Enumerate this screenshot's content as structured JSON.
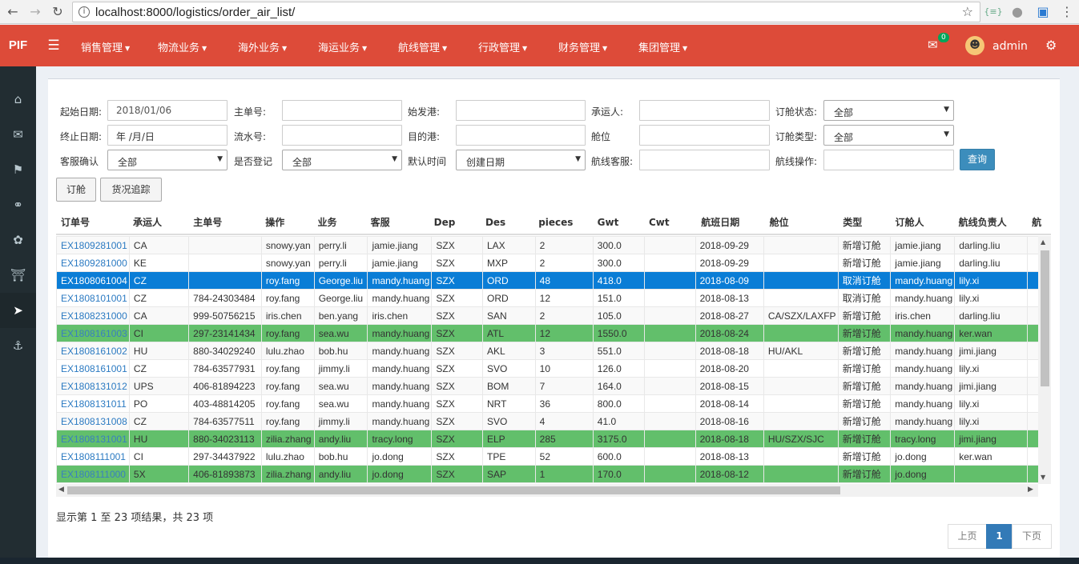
{
  "browser": {
    "url": "localhost:8000/logistics/order_air_list/",
    "back_icon": "back-arrow-icon",
    "forward_icon": "forward-arrow-icon",
    "reload_icon": "reload-icon"
  },
  "header": {
    "logo": "PIF",
    "menu": [
      "销售管理",
      "物流业务",
      "海外业务",
      "海运业务",
      "航线管理",
      "行政管理",
      "财务管理",
      "集团管理"
    ],
    "mail_count": "0",
    "username": "admin",
    "accent_color": "#dd4b39"
  },
  "sidebar": {
    "icons": [
      "home-icon",
      "envelope-icon",
      "flag-icon",
      "link-icon",
      "leaf-icon",
      "bank-icon",
      "rocket-icon",
      "anchor-icon"
    ],
    "active_index": 6
  },
  "filters": {
    "start_date": {
      "label": "起始日期:",
      "value": "2018/01/06"
    },
    "end_date": {
      "label": "终止日期:",
      "value": "年 /月/日"
    },
    "cs_confirm": {
      "label": "客服确认",
      "value": "全部"
    },
    "master_no": {
      "label": "主单号:",
      "value": ""
    },
    "serial_no": {
      "label": "流水号:",
      "value": ""
    },
    "registered": {
      "label": "是否登记",
      "value": "全部"
    },
    "origin_port": {
      "label": "始发港:",
      "value": ""
    },
    "dest_port": {
      "label": "目的港:",
      "value": ""
    },
    "default_time": {
      "label": "默认时间",
      "value": "创建日期"
    },
    "carrier": {
      "label": "承运人:",
      "value": ""
    },
    "cabin": {
      "label": "舱位",
      "value": ""
    },
    "route_cs": {
      "label": "航线客服:",
      "value": ""
    },
    "order_status": {
      "label": "订舱状态:",
      "value": "全部"
    },
    "order_type": {
      "label": "订舱类型:",
      "value": "全部"
    },
    "route_op": {
      "label": "航线操作:",
      "value": ""
    },
    "query_label": "查询"
  },
  "actions": {
    "book_label": "订舱",
    "track_label": "货况追踪"
  },
  "table": {
    "columns": [
      "订单号",
      "承运人",
      "主单号",
      "操作",
      "业务",
      "客服",
      "Dep",
      "Des",
      "pieces",
      "Gwt",
      "Cwt",
      "航班日期",
      "舱位",
      "类型",
      "订舱人",
      "航线负责人",
      "航"
    ],
    "rows": [
      {
        "style": "striped",
        "cells": [
          "EX1809281001",
          "CA",
          "",
          "snowy.yan",
          "perry.li",
          "jamie.jiang",
          "SZX",
          "LAX",
          "2",
          "300.0",
          "",
          "2018-09-29",
          "",
          "新增订舱",
          "jamie.jiang",
          "darling.liu",
          ""
        ]
      },
      {
        "style": "plain",
        "cells": [
          "EX1809281000",
          "KE",
          "",
          "snowy.yan",
          "perry.li",
          "jamie.jiang",
          "SZX",
          "MXP",
          "2",
          "300.0",
          "",
          "2018-09-29",
          "",
          "新增订舱",
          "jamie.jiang",
          "darling.liu",
          ""
        ]
      },
      {
        "style": "selected",
        "cells": [
          "EX1808061004",
          "CZ",
          "",
          "roy.fang",
          "George.liu",
          "mandy.huang",
          "SZX",
          "ORD",
          "48",
          "418.0",
          "",
          "2018-08-09",
          "",
          "取消订舱",
          "mandy.huang",
          "lily.xi",
          ""
        ]
      },
      {
        "style": "plain",
        "cells": [
          "EX1808101001",
          "CZ",
          "784-24303484",
          "roy.fang",
          "George.liu",
          "mandy.huang",
          "SZX",
          "ORD",
          "12",
          "151.0",
          "",
          "2018-08-13",
          "",
          "取消订舱",
          "mandy.huang",
          "lily.xi",
          ""
        ]
      },
      {
        "style": "striped",
        "cells": [
          "EX1808231000",
          "CA",
          "999-50756215",
          "iris.chen",
          "ben.yang",
          "iris.chen",
          "SZX",
          "SAN",
          "2",
          "105.0",
          "",
          "2018-08-27",
          "CA/SZX/LAXFP",
          "新增订舱",
          "iris.chen",
          "darling.liu",
          ""
        ]
      },
      {
        "style": "green",
        "cells": [
          "EX1808161003",
          "CI",
          "297-23141434",
          "roy.fang",
          "sea.wu",
          "mandy.huang",
          "SZX",
          "ATL",
          "12",
          "1550.0",
          "",
          "2018-08-24",
          "",
          "新增订舱",
          "mandy.huang",
          "ker.wan",
          ""
        ]
      },
      {
        "style": "striped",
        "cells": [
          "EX1808161002",
          "HU",
          "880-34029240",
          "lulu.zhao",
          "bob.hu",
          "mandy.huang",
          "SZX",
          "AKL",
          "3",
          "551.0",
          "",
          "2018-08-18",
          "HU/AKL",
          "新增订舱",
          "mandy.huang",
          "jimi.jiang",
          ""
        ]
      },
      {
        "style": "plain",
        "cells": [
          "EX1808161001",
          "CZ",
          "784-63577931",
          "roy.fang",
          "jimmy.li",
          "mandy.huang",
          "SZX",
          "SVO",
          "10",
          "126.0",
          "",
          "2018-08-20",
          "",
          "新增订舱",
          "mandy.huang",
          "lily.xi",
          ""
        ]
      },
      {
        "style": "striped",
        "cells": [
          "EX1808131012",
          "UPS",
          "406-81894223",
          "roy.fang",
          "sea.wu",
          "mandy.huang",
          "SZX",
          "BOM",
          "7",
          "164.0",
          "",
          "2018-08-15",
          "",
          "新增订舱",
          "mandy.huang",
          "jimi.jiang",
          ""
        ]
      },
      {
        "style": "plain",
        "cells": [
          "EX1808131011",
          "PO",
          "403-48814205",
          "roy.fang",
          "sea.wu",
          "mandy.huang",
          "SZX",
          "NRT",
          "36",
          "800.0",
          "",
          "2018-08-14",
          "",
          "新增订舱",
          "mandy.huang",
          "lily.xi",
          ""
        ]
      },
      {
        "style": "striped",
        "cells": [
          "EX1808131008",
          "CZ",
          "784-63577511",
          "roy.fang",
          "jimmy.li",
          "mandy.huang",
          "SZX",
          "SVO",
          "4",
          "41.0",
          "",
          "2018-08-16",
          "",
          "新增订舱",
          "mandy.huang",
          "lily.xi",
          ""
        ]
      },
      {
        "style": "green",
        "cells": [
          "EX1808131001",
          "HU",
          "880-34023113",
          "zilia.zhang",
          "andy.liu",
          "tracy.long",
          "SZX",
          "ELP",
          "285",
          "3175.0",
          "",
          "2018-08-18",
          "HU/SZX/SJC",
          "新增订舱",
          "tracy.long",
          "jimi.jiang",
          ""
        ]
      },
      {
        "style": "plain",
        "cells": [
          "EX1808111001",
          "CI",
          "297-34437922",
          "lulu.zhao",
          "bob.hu",
          "jo.dong",
          "SZX",
          "TPE",
          "52",
          "600.0",
          "",
          "2018-08-13",
          "",
          "新增订舱",
          "jo.dong",
          "ker.wan",
          ""
        ]
      },
      {
        "style": "green",
        "cells": [
          "EX1808111000",
          "5X",
          "406-81893873",
          "zilia.zhang",
          "andy.liu",
          "jo.dong",
          "SZX",
          "SAP",
          "1",
          "170.0",
          "",
          "2018-08-12",
          "",
          "新增订舱",
          "jo.dong",
          "",
          ""
        ]
      }
    ],
    "selected_color": "#0a7dd6",
    "highlight_color": "#62bf6b"
  },
  "footer": {
    "summary": "显示第 1 至 23 项结果，共 23 项",
    "prev_label": "上页",
    "page": "1",
    "next_label": "下页"
  }
}
